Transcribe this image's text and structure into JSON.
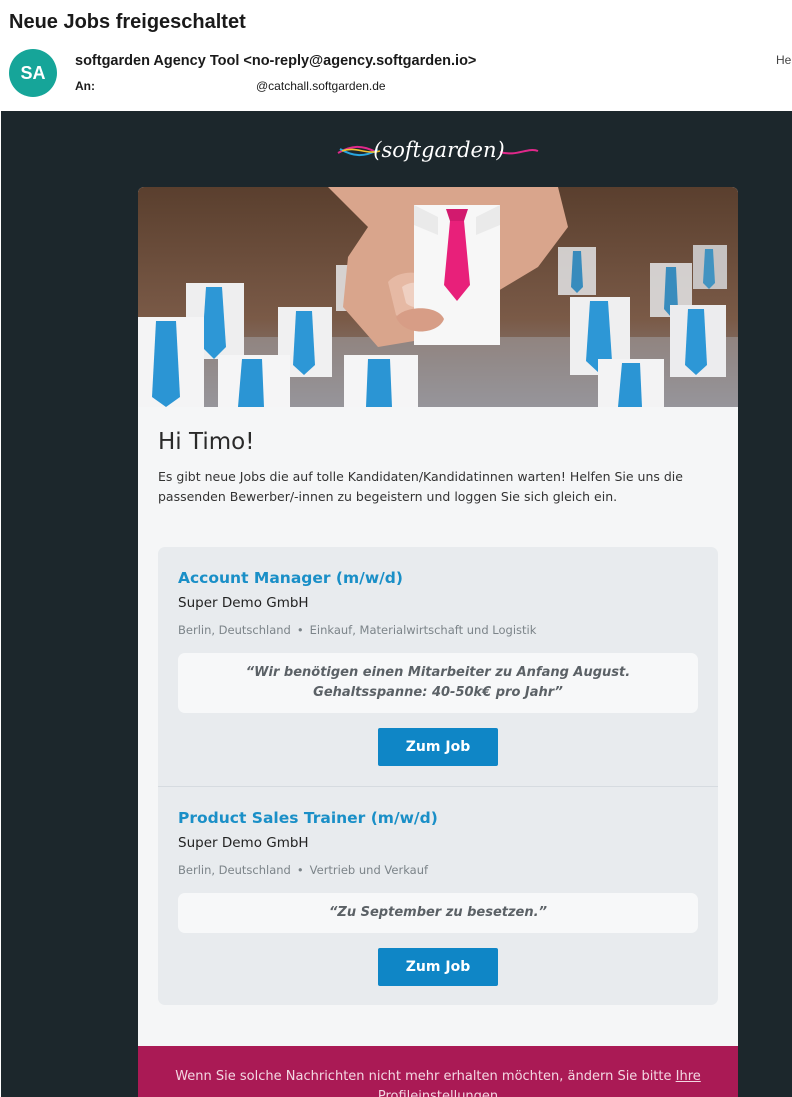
{
  "email": {
    "subject": "Neue Jobs freigeschaltet",
    "avatar_initials": "SA",
    "sender": "softgarden Agency Tool <no-reply@agency.softgarden.io>",
    "to_label": "An:",
    "to_address": "@catchall.softgarden.de",
    "header_cut_text": "He"
  },
  "brand": {
    "logo_text": "(softgarden)",
    "colors": {
      "dark_bg": "#1c272c",
      "accent_blue": "#0f86c6",
      "footer_magenta": "#aa1a55",
      "avatar_teal": "#16a599"
    }
  },
  "content": {
    "greeting": "Hi Timo!",
    "intro": "Es gibt neue Jobs die auf tolle Kandidaten/Kandidatinnen warten! Helfen Sie uns die passenden Bewerber/-innen zu begeistern und loggen Sie sich gleich ein."
  },
  "jobs": [
    {
      "title": "Account Manager (m/w/d)",
      "company": "Super Demo GmbH",
      "location": "Berlin, Deutschland",
      "category": "Einkauf, Materialwirtschaft und Logistik",
      "quote": "“Wir benötigen einen Mitarbeiter zu Anfang August. Gehaltsspanne: 40-50k€ pro Jahr”",
      "button": "Zum Job"
    },
    {
      "title": "Product Sales Trainer (m/w/d)",
      "company": "Super Demo GmbH",
      "location": "Berlin, Deutschland",
      "category": "Vertrieb und Verkauf",
      "quote": "“Zu September zu besetzen.”",
      "button": "Zum Job"
    }
  ],
  "footer": {
    "text": "Wenn Sie solche Nachrichten nicht mehr erhalten möchten, ändern Sie bitte",
    "link": "Ihre Profileinstellungen"
  }
}
